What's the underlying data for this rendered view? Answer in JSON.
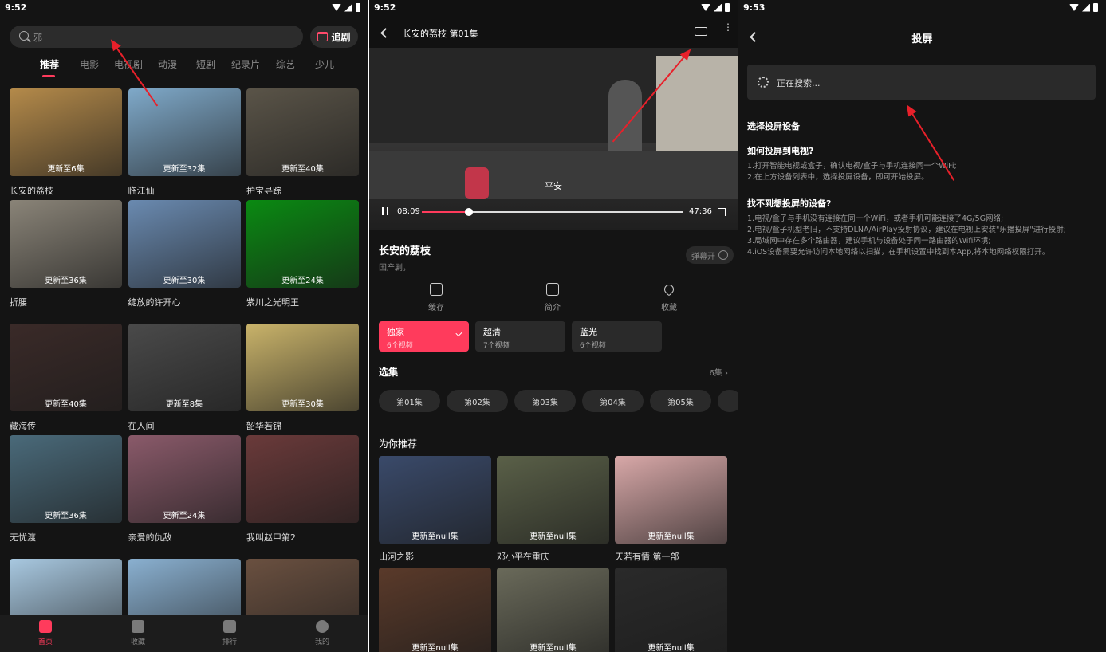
{
  "panel1": {
    "status_time": "9:52",
    "search_placeholder": "邪",
    "follow_label": "追剧",
    "tabs": [
      "推荐",
      "电影",
      "电视剧",
      "动漫",
      "短剧",
      "纪录片",
      "综艺",
      "少儿"
    ],
    "cards": [
      {
        "title": "长安的荔枝",
        "badge": "更新至6集",
        "color": "#b48a4a"
      },
      {
        "title": "临江仙",
        "badge": "更新至32集",
        "color": "#7fa9c9"
      },
      {
        "title": "护宝寻踪",
        "badge": "更新至40集",
        "color": "#5a5448"
      },
      {
        "title": "折腰",
        "badge": "更新至36集",
        "color": "#8a8478"
      },
      {
        "title": "绽放的许开心",
        "badge": "更新至30集",
        "color": "#6a8ab0"
      },
      {
        "title": "紫川之光明王",
        "badge": "更新至24集",
        "color": "#0a8a12"
      },
      {
        "title": "藏海传",
        "badge": "更新至40集",
        "color": "#3a2a28"
      },
      {
        "title": "在人间",
        "badge": "更新至8集",
        "color": "#4a4a4a"
      },
      {
        "title": "韶华若锦",
        "badge": "更新至30集",
        "color": "#c9b36a"
      },
      {
        "title": "无忧渡",
        "badge": "更新至36集",
        "color": "#4a6a7a"
      },
      {
        "title": "亲爱的仇敌",
        "badge": "更新至24集",
        "color": "#8a5a6a"
      },
      {
        "title": "我叫赵甲第2",
        "badge": "",
        "color": "#6a3a3a"
      },
      {
        "title": "",
        "badge": "",
        "color": "#a8c8e0"
      },
      {
        "title": "",
        "badge": "",
        "color": "#8ab0d0"
      },
      {
        "title": "",
        "badge": "",
        "color": "#6a5040"
      }
    ],
    "nav": [
      "首页",
      "收藏",
      "排行",
      "我的"
    ]
  },
  "panel2": {
    "status_time": "9:52",
    "episode_title": "长安的荔枝 第01集",
    "subtitle": "平安",
    "time_current": "08:09",
    "time_total": "47:36",
    "progress": 0.18,
    "show_title": "长安的荔枝",
    "show_meta": "国产剧，",
    "danmu_label": "弹幕开",
    "actions": [
      "缓存",
      "简介",
      "收藏"
    ],
    "qualities": [
      {
        "name": "独家",
        "count": "6个视频"
      },
      {
        "name": "超清",
        "count": "7个视频"
      },
      {
        "name": "蓝光",
        "count": "6个视频"
      }
    ],
    "episodes_title": "选集",
    "episodes_count": "6集",
    "episodes": [
      "第01集",
      "第02集",
      "第03集",
      "第04集",
      "第05集"
    ],
    "recommend_title": "为你推荐",
    "recommend": [
      {
        "title": "山河之影",
        "badge": "更新至null集",
        "color": "#3a4a6a"
      },
      {
        "title": "邓小平在重庆",
        "badge": "更新至null集",
        "color": "#5a6048"
      },
      {
        "title": "天若有情 第一部",
        "badge": "更新至null集",
        "color": "#d8a8a8"
      },
      {
        "title": "",
        "badge": "更新至null集",
        "color": "#5a3a2a"
      },
      {
        "title": "",
        "badge": "更新至null集",
        "color": "#6a6a5a"
      },
      {
        "title": "",
        "badge": "更新至null集",
        "color": "#2a2a2a"
      }
    ]
  },
  "panel3": {
    "status_time": "9:53",
    "title": "投屏",
    "searching": "正在搜索...",
    "choose": "选择投屏设备",
    "how_title": "如何投屏到电视?",
    "how_lines": [
      "1.打开智能电视或盒子，确认电视/盒子与手机连接同一个WiFi;",
      "2.在上方设备列表中，选择投屏设备，即可开始投屏。"
    ],
    "notfound_title": "找不到想投屏的设备?",
    "notfound_lines": [
      "1.电视/盒子与手机没有连接在同一个WiFi，或者手机可能连接了4G/5G网络;",
      "2.电视/盒子机型老旧，不支持DLNA/AirPlay投射协议，建议在电视上安装\"乐播投屏\"进行投射;",
      "3.局域网中存在多个路由器，建议手机与设备处于同一路由器的Wifi环境;",
      "4.iOS设备需要允许访问本地网络以扫描，在手机设置中找到本App,将本地网络权限打开。"
    ]
  },
  "colors": {
    "accent": "#ff3b5c",
    "annotation": "#e8202a",
    "background": "#141414"
  }
}
